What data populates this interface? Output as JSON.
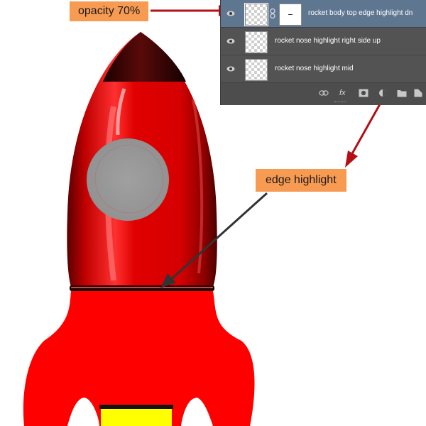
{
  "callouts": {
    "opacity": "opacity 70%",
    "edge": "edge highlight"
  },
  "layers_panel": {
    "layers": [
      {
        "name": "rocket body top edge highlight dn",
        "selected": true,
        "has_mask": true
      },
      {
        "name": "rocket nose highlight right side up",
        "selected": false,
        "has_mask": false
      },
      {
        "name": "rocket nose highlight mid",
        "selected": false,
        "has_mask": false
      }
    ],
    "footer_fx": "fx"
  },
  "colors": {
    "callout_bg": "#f79a52",
    "arrow_red": "#b30f14",
    "arrow_dark": "#333333",
    "panel_bg": "#535353",
    "selected_row": "#5f7691",
    "rocket_red": "#e00000",
    "window_gray": "#9b9b9b"
  },
  "icons": {
    "visibility": "eye-icon",
    "chain": "chain-link-icon",
    "link": "link-layers-icon",
    "fx": "fx-icon",
    "mask": "add-mask-icon",
    "adjustment": "adjustment-layer-icon",
    "folder": "new-group-icon",
    "new_layer": "new-layer-icon"
  }
}
